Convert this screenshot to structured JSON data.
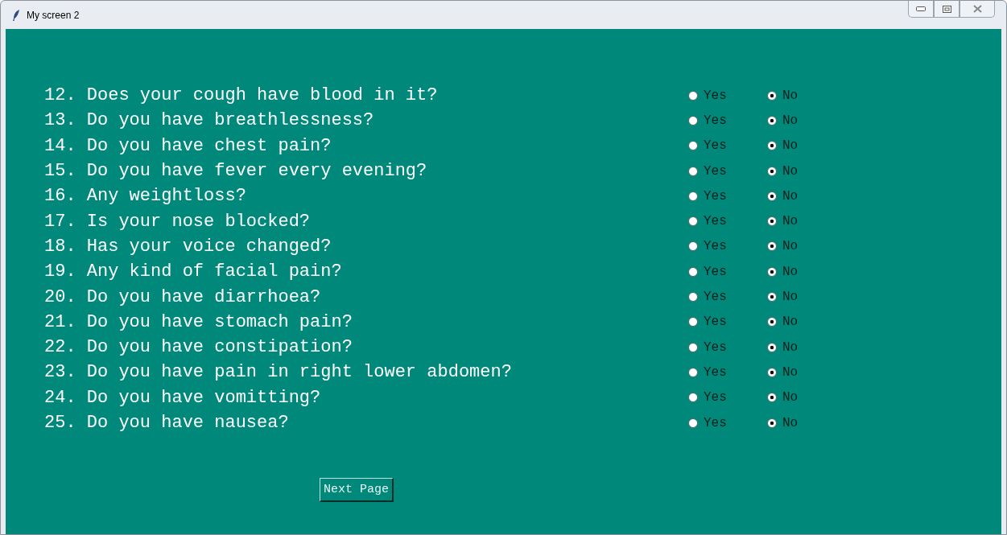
{
  "window": {
    "title": "My screen 2"
  },
  "questions": [
    {
      "text": "12. Does your cough have blood in it?",
      "options": [
        {
          "label": "Yes",
          "selected": false
        },
        {
          "label": "No",
          "selected": true
        }
      ]
    },
    {
      "text": "13. Do you have breathlessness?",
      "options": [
        {
          "label": "Yes",
          "selected": false
        },
        {
          "label": "No",
          "selected": true
        }
      ]
    },
    {
      "text": "14. Do you have chest pain?",
      "options": [
        {
          "label": "Yes",
          "selected": false
        },
        {
          "label": "No",
          "selected": true
        }
      ]
    },
    {
      "text": "15. Do you have fever every evening?",
      "options": [
        {
          "label": "Yes",
          "selected": false
        },
        {
          "label": "No",
          "selected": true
        }
      ]
    },
    {
      "text": "16. Any weightloss?",
      "options": [
        {
          "label": "Yes",
          "selected": false
        },
        {
          "label": "No",
          "selected": true
        }
      ]
    },
    {
      "text": "17. Is your nose blocked?",
      "options": [
        {
          "label": "Yes",
          "selected": false
        },
        {
          "label": "No",
          "selected": true
        }
      ]
    },
    {
      "text": "18. Has your voice changed?",
      "options": [
        {
          "label": "Yes",
          "selected": false
        },
        {
          "label": "No",
          "selected": true
        }
      ]
    },
    {
      "text": "19. Any kind of facial pain?",
      "options": [
        {
          "label": "Yes",
          "selected": false
        },
        {
          "label": "No",
          "selected": true
        }
      ]
    },
    {
      "text": "20. Do you have diarrhoea?",
      "options": [
        {
          "label": "Yes",
          "selected": false
        },
        {
          "label": "No",
          "selected": true
        }
      ]
    },
    {
      "text": "21. Do you have stomach pain?",
      "options": [
        {
          "label": "Yes",
          "selected": false
        },
        {
          "label": "No",
          "selected": true
        }
      ]
    },
    {
      "text": "22. Do you have constipation?",
      "options": [
        {
          "label": "Yes",
          "selected": false
        },
        {
          "label": "No",
          "selected": true
        }
      ]
    },
    {
      "text": "23. Do you have pain in right lower abdomen?",
      "options": [
        {
          "label": "Yes",
          "selected": false
        },
        {
          "label": "No",
          "selected": true
        }
      ]
    },
    {
      "text": "24. Do you have vomitting?",
      "options": [
        {
          "label": "Yes",
          "selected": false
        },
        {
          "label": "No",
          "selected": true
        }
      ]
    },
    {
      "text": "25. Do you have nausea?",
      "options": [
        {
          "label": "Yes",
          "selected": false
        },
        {
          "label": "No",
          "selected": true
        }
      ]
    }
  ],
  "next_button": {
    "label": "Next Page"
  }
}
